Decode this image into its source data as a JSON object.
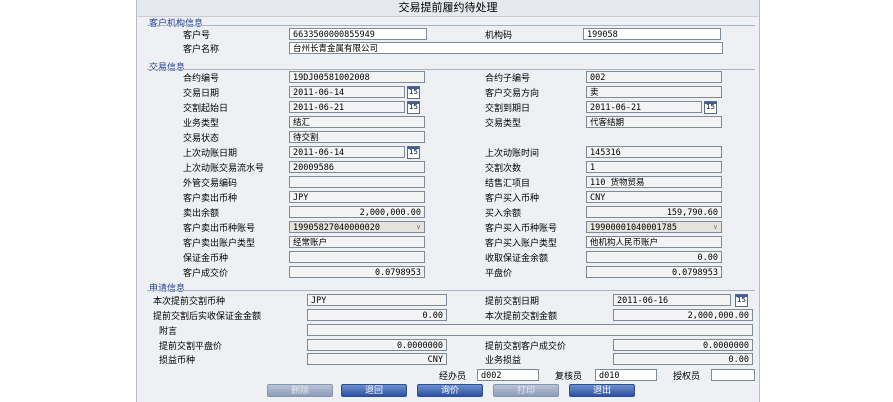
{
  "title": "交易提前履约待处理",
  "sec1": {
    "label": "客户机构信息",
    "cust_no_label": "客户号",
    "cust_no": "6633500000855949",
    "org_label": "机构码",
    "org": "199058",
    "cust_name_label": "客户名称",
    "cust_name": "台州长青金属有限公司"
  },
  "sec2": {
    "label": "交易信息",
    "contract_no_label": "合约编号",
    "contract_no": "19DJ00581002008",
    "sub_no_label": "合约子编号",
    "sub_no": "002",
    "trade_date_label": "交易日期",
    "trade_date": "2011-06-14",
    "direction_label": "客户交易方向",
    "direction": "卖",
    "start_date_label": "交割起始日",
    "start_date": "2011-06-21",
    "end_date_label": "交割到期日",
    "end_date": "2011-06-21",
    "biz_type_label": "业务类型",
    "biz_type": "结汇",
    "trade_type_label": "交易类型",
    "trade_type": "代客结期",
    "status_label": "交易状态",
    "status": "待交割",
    "last_date_label": "上次动账日期",
    "last_date": "2011-06-14",
    "last_time_label": "上次动账时间",
    "last_time": "145316",
    "last_seq_label": "上次动账交易流水号",
    "last_seq": "20009586",
    "count_label": "交割次数",
    "count": "1",
    "fx_code_label": "外管交易编码",
    "fx_code": "",
    "item_label": "结售汇项目",
    "item": "110   货物贸易",
    "sell_ccy_label": "客户卖出币种",
    "sell_ccy": "JPY",
    "buy_ccy_label": "客户买入币种",
    "buy_ccy": "CNY",
    "sell_bal_label": "卖出余额",
    "sell_bal": "2,000,000.00",
    "buy_bal_label": "买入余额",
    "buy_bal": "159,790.60",
    "sell_acct_label": "客户卖出币种账号",
    "sell_acct": "19905827040000020",
    "buy_acct_label": "客户买入币种账号",
    "buy_acct": "19900001040001785",
    "sell_acct_type_label": "客户卖出账户类型",
    "sell_acct_type": "经常账户",
    "buy_acct_type_label": "客户买入账户类型",
    "buy_acct_type": "他机构人民币账户",
    "margin_ccy_label": "保证金币种",
    "margin_ccy": "",
    "margin_bal_label": "收取保证金余额",
    "margin_bal": "0.00",
    "cust_rate_label": "客户成交价",
    "cust_rate": "0.0798953",
    "close_rate_label": "平盘价",
    "close_rate": "0.0798953"
  },
  "sec3": {
    "label": "申请信息",
    "early_ccy_label": "本次提前交割币种",
    "early_ccy": "JPY",
    "early_date_label": "提前交割日期",
    "early_date": "2011-06-16",
    "margin_after_label": "提前交割后实收保证金金额",
    "margin_after": "0.00",
    "early_amt_label": "本次提前交割金额",
    "early_amt": "2,000,000.00",
    "remark_label": "附言",
    "remark": "",
    "early_close_label": "提前交割平盘价",
    "early_close": "0.0000000",
    "early_cust_label": "提前交割客户成交价",
    "early_cust": "0.0000000",
    "pl_ccy_label": "损益币种",
    "pl_ccy": "CNY",
    "pl_label": "业务损益",
    "pl": "0.00"
  },
  "footer": {
    "handler_label": "经办员",
    "handler": "d002",
    "checker_label": "复核员",
    "checker": "d010",
    "auth_label": "授权员",
    "auth": ""
  },
  "buttons": {
    "delete": "删除",
    "back": "退回",
    "query": "询价",
    "print": "打印",
    "exit": "退出"
  },
  "cal_glyph": "15",
  "dd_glyph": "∨"
}
